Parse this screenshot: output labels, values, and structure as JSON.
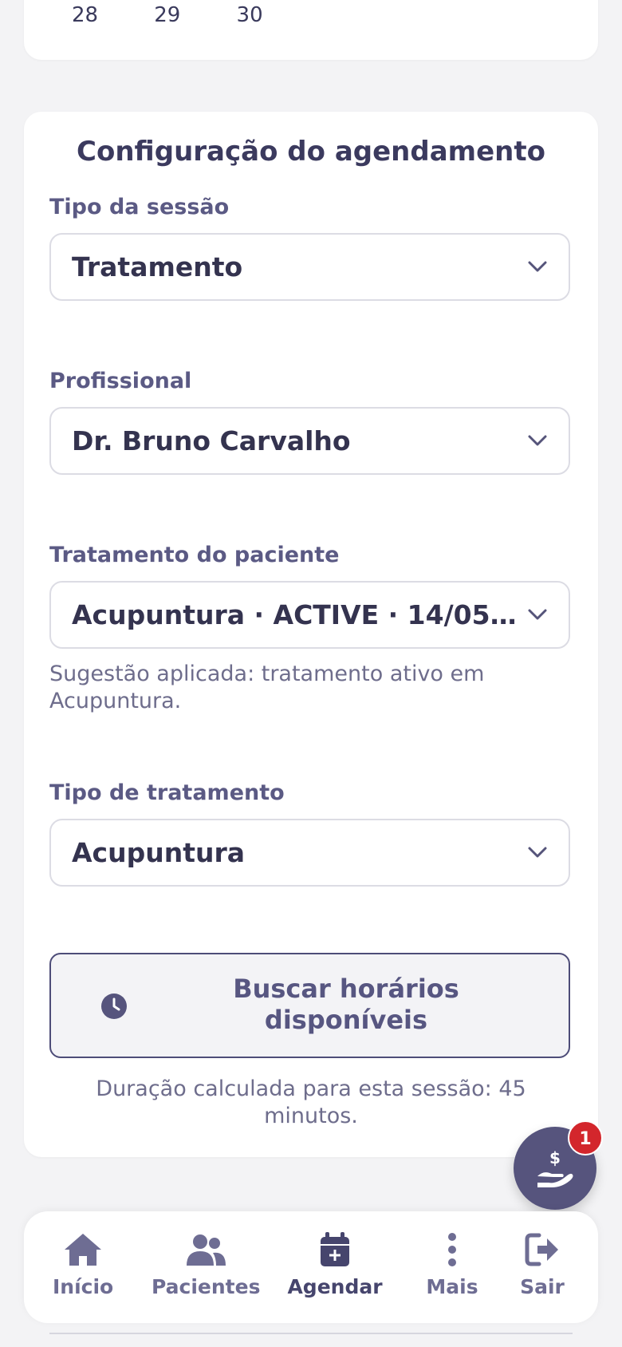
{
  "calendar": {
    "visible_days": [
      "28",
      "29",
      "30"
    ]
  },
  "config": {
    "title": "Configuração do agendamento",
    "session_type": {
      "label": "Tipo da sessão",
      "value": "Tratamento"
    },
    "professional": {
      "label": "Profissional",
      "value": "Dr. Bruno Carvalho"
    },
    "patient_treatment": {
      "label": "Tratamento do paciente",
      "value": "Acupuntura · ACTIVE · 14/05...",
      "hint": "Sugestão aplicada: tratamento ativo em Acupuntura."
    },
    "treatment_type": {
      "label": "Tipo de tratamento",
      "value": "Acupuntura"
    },
    "search_button": {
      "label_line1": "Buscar horários",
      "label_line2": "disponíveis",
      "icon": "clock-icon"
    },
    "duration_text": "Duração calculada para esta sessão: 45 minutos."
  },
  "fab": {
    "icon": "hand-dollar-icon",
    "badge": "1",
    "badge_color": "#d3262c"
  },
  "nav": {
    "items": [
      {
        "label": "Início",
        "icon": "home-icon"
      },
      {
        "label": "Pacientes",
        "icon": "users-icon"
      },
      {
        "label": "Agendar",
        "icon": "calendar-plus-icon",
        "active": true
      },
      {
        "label": "Mais",
        "icon": "more-vertical-icon"
      },
      {
        "label": "Sair",
        "icon": "logout-icon"
      }
    ]
  },
  "colors": {
    "accent": "#56547d",
    "background": "#f3f3f5",
    "card": "#ffffff"
  }
}
